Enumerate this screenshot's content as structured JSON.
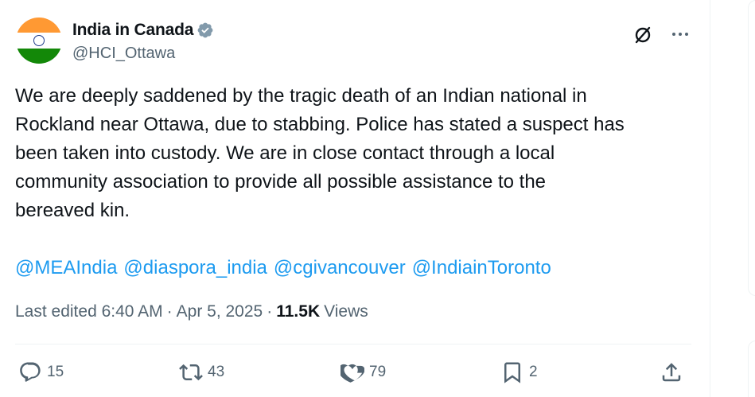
{
  "author": {
    "display_name": "India in Canada",
    "handle": "@HCI_Ottawa",
    "verified_icon": "verified-badge-icon",
    "avatar_colors": [
      "#ff9933",
      "#ffffff",
      "#138808"
    ]
  },
  "tweet": {
    "text": "We are deeply saddened by the tragic death of an Indian national in\nRockland near Ottawa, due to stabbing. Police has stated a suspect has\nbeen taken into custody. We are in close contact through a local\ncommunity association to provide all possible assistance to the\nbereaved kin.",
    "mentions": [
      "@MEAIndia",
      "@diaspora_india",
      "@cgivancouver",
      "@IndiainToronto"
    ],
    "edited_label": "Last edited 6:40 AM",
    "separator": "·",
    "date": "Apr 5, 2025",
    "views_count": "11.5K",
    "views_label": "Views"
  },
  "actions": {
    "replies": "15",
    "reposts": "43",
    "likes": "79",
    "bookmarks": "2"
  },
  "colors": {
    "link": "#1d9bf0",
    "secondary_text": "#536471",
    "verified": "#829aab"
  }
}
